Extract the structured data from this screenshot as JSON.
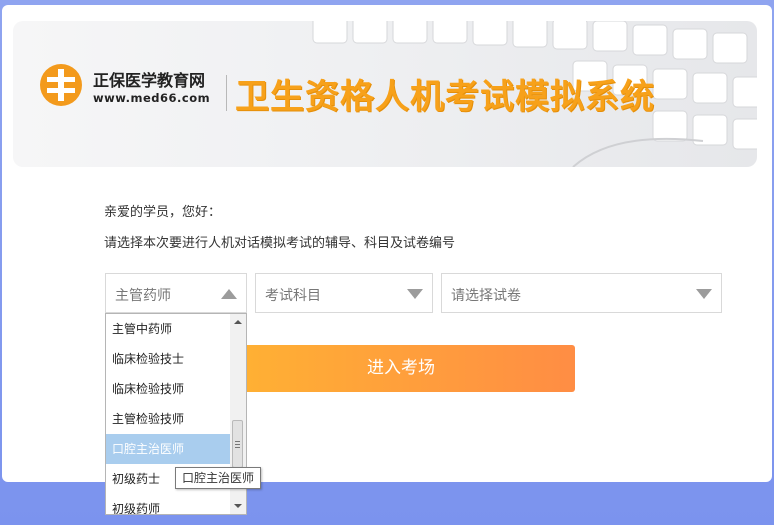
{
  "banner": {
    "logo_name": "正保医学教育网",
    "logo_url": "www.med66.com",
    "headline": "卫生资格人机考试模拟系统"
  },
  "intro": {
    "greeting": "亲爱的学员，您好：",
    "instruction": "请选择本次要进行人机对话模拟考试的辅导、科目及试卷编号"
  },
  "selects": {
    "category": {
      "value": "主管药师"
    },
    "subject": {
      "placeholder": "考试科目"
    },
    "paper": {
      "placeholder": "请选择试卷"
    }
  },
  "enter_button": {
    "label": "进入考场"
  },
  "dropdown": {
    "options": [
      "主管中药师",
      "临床检验技士",
      "临床检验技师",
      "主管检验技师",
      "口腔主治医师",
      "初级药士",
      "初级药师"
    ],
    "highlighted": "口腔主治医师"
  },
  "tooltip": {
    "text": "口腔主治医师"
  },
  "colors": {
    "accent": "#f7a11a",
    "button_start": "#ffb233",
    "button_end": "#ff8d44",
    "highlight": "#a9cdee",
    "background": "#8fa4f0"
  },
  "icons": [
    "logo-icon",
    "chevron-up-icon",
    "chevron-down-icon",
    "scroll-up-icon",
    "scroll-down-icon"
  ]
}
